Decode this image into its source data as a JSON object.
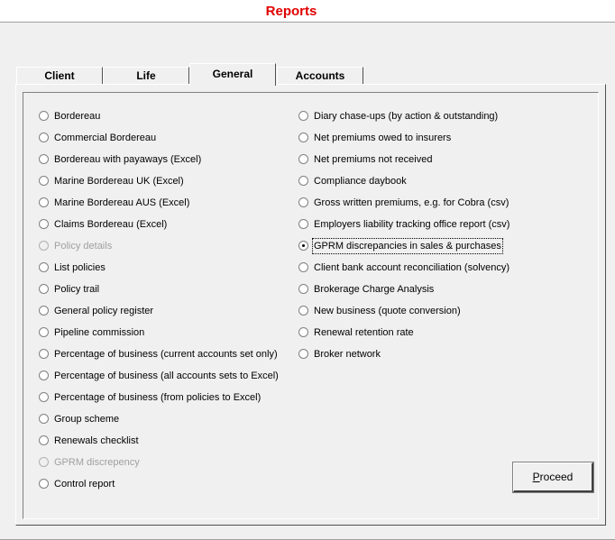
{
  "window": {
    "title": "Reports"
  },
  "tabs": [
    {
      "label": "Client",
      "active": false
    },
    {
      "label": "Life",
      "active": false
    },
    {
      "label": "General",
      "active": true
    },
    {
      "label": "Accounts",
      "active": false
    }
  ],
  "left_options": [
    {
      "label": "Bordereau",
      "selected": false,
      "disabled": false
    },
    {
      "label": "Commercial Bordereau",
      "selected": false,
      "disabled": false
    },
    {
      "label": "Bordereau with payaways (Excel)",
      "selected": false,
      "disabled": false
    },
    {
      "label": "Marine Bordereau UK (Excel)",
      "selected": false,
      "disabled": false
    },
    {
      "label": "Marine Bordereau AUS (Excel)",
      "selected": false,
      "disabled": false
    },
    {
      "label": "Claims Bordereau (Excel)",
      "selected": false,
      "disabled": false
    },
    {
      "label": "Policy details",
      "selected": false,
      "disabled": true
    },
    {
      "label": "List policies",
      "selected": false,
      "disabled": false
    },
    {
      "label": "Policy trail",
      "selected": false,
      "disabled": false
    },
    {
      "label": "General policy register",
      "selected": false,
      "disabled": false
    },
    {
      "label": "Pipeline commission",
      "selected": false,
      "disabled": false
    },
    {
      "label": "Percentage of business (current accounts set only)",
      "selected": false,
      "disabled": false
    },
    {
      "label": "Percentage of business (all accounts sets to Excel)",
      "selected": false,
      "disabled": false
    },
    {
      "label": "Percentage of business (from policies to Excel)",
      "selected": false,
      "disabled": false
    },
    {
      "label": "Group scheme",
      "selected": false,
      "disabled": false
    },
    {
      "label": "Renewals checklist",
      "selected": false,
      "disabled": false
    },
    {
      "label": "GPRM discrepency",
      "selected": false,
      "disabled": true
    },
    {
      "label": "Control report",
      "selected": false,
      "disabled": false
    }
  ],
  "right_options": [
    {
      "label": "Diary chase-ups (by action & outstanding)",
      "selected": false,
      "disabled": false
    },
    {
      "label": "Net premiums owed to insurers",
      "selected": false,
      "disabled": false
    },
    {
      "label": "Net premiums not received",
      "selected": false,
      "disabled": false
    },
    {
      "label": "Compliance daybook",
      "selected": false,
      "disabled": false
    },
    {
      "label": "Gross written premiums, e.g. for Cobra (csv)",
      "selected": false,
      "disabled": false
    },
    {
      "label": "Employers liability tracking office report (csv)",
      "selected": false,
      "disabled": false
    },
    {
      "label": "GPRM discrepancies in sales & purchases",
      "selected": true,
      "disabled": false
    },
    {
      "label": "Client bank account reconciliation (solvency)",
      "selected": false,
      "disabled": false
    },
    {
      "label": "Brokerage Charge Analysis",
      "selected": false,
      "disabled": false
    },
    {
      "label": "New business (quote conversion)",
      "selected": false,
      "disabled": false
    },
    {
      "label": "Renewal retention rate",
      "selected": false,
      "disabled": false
    },
    {
      "label": "Broker network",
      "selected": false,
      "disabled": false
    }
  ],
  "proceed_button": {
    "mnemonic": "P",
    "rest": "roceed"
  },
  "colors": {
    "title": "#e00000",
    "background": "#f0f0f0"
  }
}
